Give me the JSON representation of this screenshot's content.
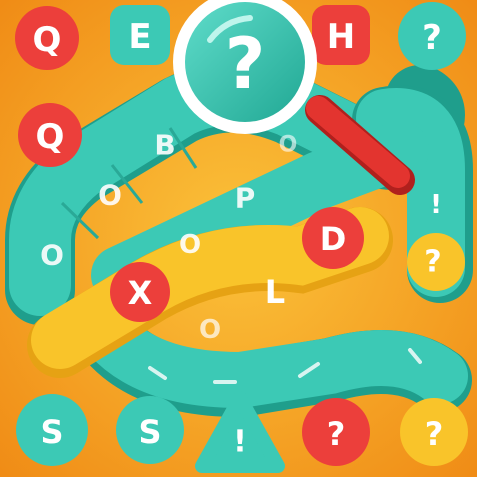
{
  "colors": {
    "background": "#f6a81a",
    "teal": "#3cc9b5",
    "teal_dark": "#1f9e8c",
    "red": "#ec3f3b",
    "yellow": "#f9c42a",
    "white": "#ffffff",
    "magnifier_handle": "#e3342f"
  },
  "corner_tiles": {
    "top_left_q": "Q",
    "top_e": "E",
    "top_h": "H",
    "top_right_question": "?",
    "left_q": "Q"
  },
  "magnifier": {
    "icon": "magnifier-icon",
    "symbol": "?"
  },
  "upper_snake": {
    "letters": [
      "B",
      "O",
      "P",
      "O",
      "O",
      "O"
    ]
  },
  "right_tube": {
    "letters": [
      "!",
      "?"
    ]
  },
  "lower_snake": {
    "letters": [
      "X",
      "L",
      "O",
      "D"
    ]
  },
  "bottom_row": {
    "s1": "S",
    "s2": "S",
    "warning": "!",
    "question": "?",
    "last": "?"
  }
}
